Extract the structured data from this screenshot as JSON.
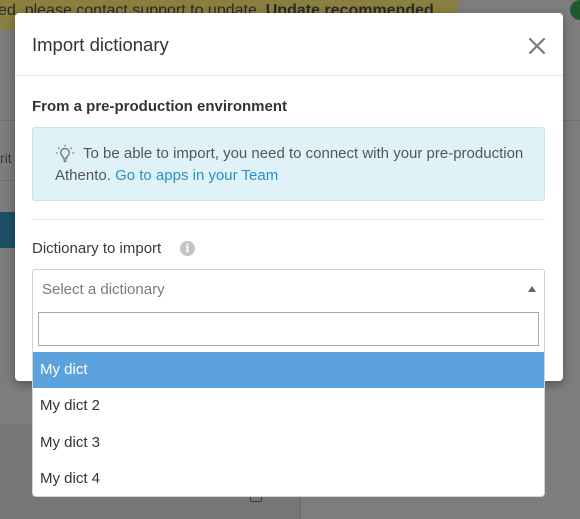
{
  "background": {
    "banner_text": "ed, please contact support to update.",
    "banner_strong": "Update recommended",
    "side_text": "rit"
  },
  "modal": {
    "title": "Import dictionary",
    "close_icon": "close-icon",
    "section_title": "From a pre-production environment",
    "info": {
      "icon": "lightbulb-icon",
      "text": "To be able to import, you need to connect with your pre-production Athento.",
      "link": "Go to apps in your Team"
    },
    "field_label": "Dictionary to import",
    "help_icon": "i"
  },
  "select": {
    "placeholder": "Select a dictionary",
    "search_value": "",
    "options": [
      "My dict",
      "My dict 2",
      "My dict 3",
      "My dict 4"
    ],
    "active_index": 0
  },
  "colors": {
    "info_bg": "#dff2f8",
    "link": "#2b8fc7",
    "highlight": "#5ca3de"
  }
}
